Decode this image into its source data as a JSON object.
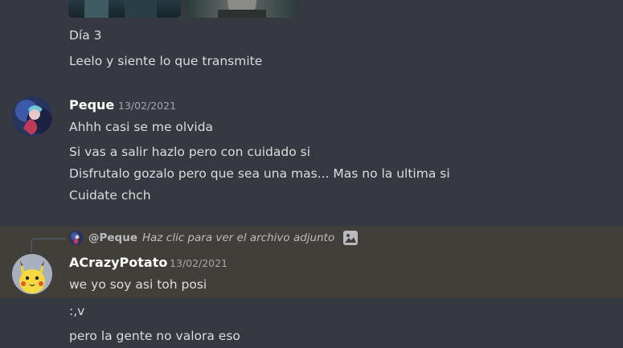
{
  "colors": {
    "background": "#36393f",
    "highlight": "#423f3a",
    "text": "#dcddde",
    "username": "#ffffff",
    "timestamp": "#a3a6aa",
    "reply_text": "#b9bbbe"
  },
  "top_attachment": {
    "icon": "image-attachment-thumbnails"
  },
  "previous_message": {
    "lines": [
      "Día 3",
      "Leelo y siente lo que transmite"
    ]
  },
  "message_peque": {
    "avatar_icon": "anime-character-avatar",
    "username": "Peque",
    "timestamp": "13/02/2021",
    "lines": [
      "Ahhh casi se me olvida",
      "Si vas a salir hazlo pero con cuidado si",
      "Disfrutalo gozalo pero que sea una mas... Mas no la ultima si",
      "Cuidate chch"
    ]
  },
  "message_acrazypotato": {
    "reply": {
      "avatar_icon": "peque-mini-avatar",
      "user": "@Peque",
      "text": "Haz clic para ver el archivo adjunto",
      "image_icon": "image-icon"
    },
    "avatar_icon": "pikachu-avatar",
    "username": "ACrazyPotato",
    "timestamp": "13/02/2021",
    "lines": [
      "we yo soy asi toh posi",
      ":,v",
      "pero la gente no valora eso"
    ]
  }
}
